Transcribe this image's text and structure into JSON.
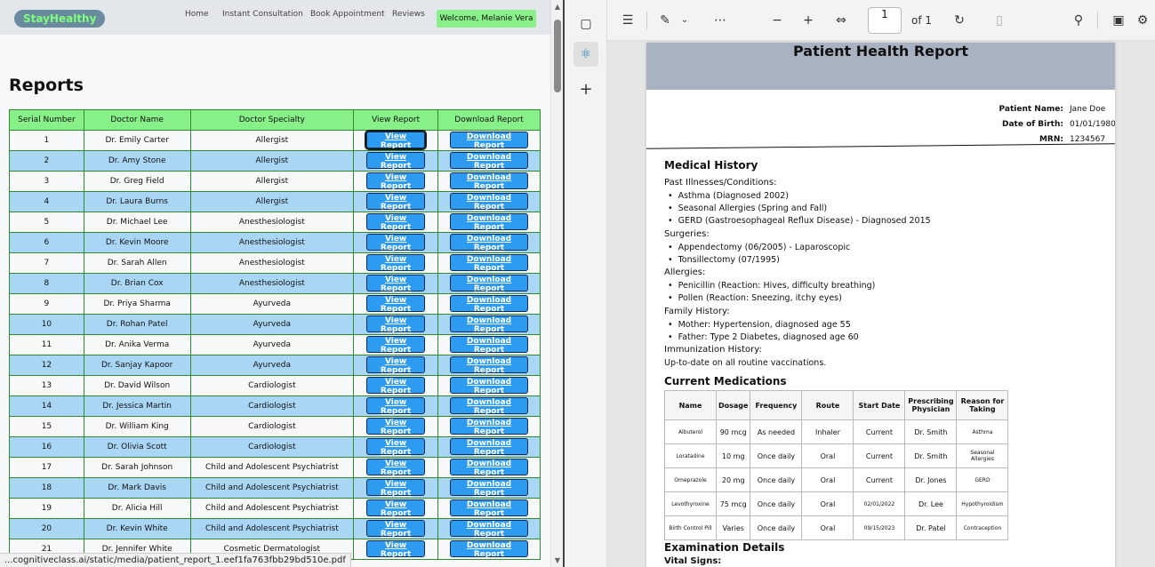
{
  "site": {
    "brand": "StayHealthy",
    "nav": [
      "Home",
      "Instant Consultation",
      "Book Appointment",
      "Reviews"
    ],
    "welcome": "Welcome, Melanie Vera",
    "page_title": "Reports",
    "table_headers": [
      "Serial Number",
      "Doctor Name",
      "Doctor Specialty",
      "View Report",
      "Download Report"
    ],
    "view_label": "View Report",
    "download_label": "Download Report",
    "rows": [
      {
        "n": "1",
        "doctor": "Dr. Emily Carter",
        "specialty": "Allergist"
      },
      {
        "n": "2",
        "doctor": "Dr. Amy Stone",
        "specialty": "Allergist"
      },
      {
        "n": "3",
        "doctor": "Dr. Greg Field",
        "specialty": "Allergist"
      },
      {
        "n": "4",
        "doctor": "Dr. Laura Burns",
        "specialty": "Allergist"
      },
      {
        "n": "5",
        "doctor": "Dr. Michael Lee",
        "specialty": "Anesthesiologist"
      },
      {
        "n": "6",
        "doctor": "Dr. Kevin Moore",
        "specialty": "Anesthesiologist"
      },
      {
        "n": "7",
        "doctor": "Dr. Sarah Allen",
        "specialty": "Anesthesiologist"
      },
      {
        "n": "8",
        "doctor": "Dr. Brian Cox",
        "specialty": "Anesthesiologist"
      },
      {
        "n": "9",
        "doctor": "Dr. Priya Sharma",
        "specialty": "Ayurveda"
      },
      {
        "n": "10",
        "doctor": "Dr. Rohan Patel",
        "specialty": "Ayurveda"
      },
      {
        "n": "11",
        "doctor": "Dr. Anika Verma",
        "specialty": "Ayurveda"
      },
      {
        "n": "12",
        "doctor": "Dr. Sanjay Kapoor",
        "specialty": "Ayurveda"
      },
      {
        "n": "13",
        "doctor": "Dr. David Wilson",
        "specialty": "Cardiologist"
      },
      {
        "n": "14",
        "doctor": "Dr. Jessica Martin",
        "specialty": "Cardiologist"
      },
      {
        "n": "15",
        "doctor": "Dr. William King",
        "specialty": "Cardiologist"
      },
      {
        "n": "16",
        "doctor": "Dr. Olivia Scott",
        "specialty": "Cardiologist"
      },
      {
        "n": "17",
        "doctor": "Dr. Sarah Johnson",
        "specialty": "Child and Adolescent Psychiatrist"
      },
      {
        "n": "18",
        "doctor": "Dr. Mark Davis",
        "specialty": "Child and Adolescent Psychiatrist"
      },
      {
        "n": "19",
        "doctor": "Dr. Alicia Hill",
        "specialty": "Child and Adolescent Psychiatrist"
      },
      {
        "n": "20",
        "doctor": "Dr. Kevin White",
        "specialty": "Child and Adolescent Psychiatrist"
      },
      {
        "n": "21",
        "doctor": "Dr. Jennifer White",
        "specialty": "Cosmetic Dermatologist"
      }
    ],
    "status_url": "...cognitiveclass.ai/static/media/patient_report_1.eef1fa763fbb29bd510e.pdf"
  },
  "viewer": {
    "page_current": "1",
    "page_of": "of 1",
    "toolbar_icons": [
      "contents-icon",
      "draw-icon",
      "chevron-down-icon",
      "more-icon",
      "zoom-out-icon",
      "zoom-in-icon",
      "fit-width-icon",
      "rotate-icon",
      "two-page-icon",
      "search-icon",
      "save-icon",
      "settings-icon"
    ]
  },
  "pdf": {
    "title": "Patient Health Report",
    "patient": [
      {
        "label": "Patient Name:",
        "value": "Jane Doe"
      },
      {
        "label": "Date of Birth:",
        "value": "01/01/1980"
      },
      {
        "label": "MRN:",
        "value": "1234567"
      }
    ],
    "medical_history_title": "Medical History",
    "past_title": "Past Illnesses/Conditions:",
    "past": [
      "Asthma (Diagnosed 2002)",
      "Seasonal Allergies (Spring and Fall)",
      "GERD (Gastroesophageal Reflux Disease) - Diagnosed 2015"
    ],
    "surgeries_title": "Surgeries:",
    "surgeries": [
      "Appendectomy (06/2005) - Laparoscopic",
      "Tonsillectomy (07/1995)"
    ],
    "allergies_title": "Allergies:",
    "allergies": [
      "Penicillin (Reaction: Hives, difficulty breathing)",
      "Pollen (Reaction: Sneezing, itchy eyes)"
    ],
    "family_title": "Family History:",
    "family": [
      "Mother: Hypertension, diagnosed age 55",
      "Father: Type 2 Diabetes, diagnosed age 60"
    ],
    "immunization_title": "Immunization History:",
    "immunization": "Up-to-date on all routine vaccinations.",
    "meds_title": "Current Medications",
    "meds_headers": [
      "Name",
      "Dosage",
      "Frequency",
      "Route",
      "Start Date",
      "Prescribing Physician",
      "Reason for Taking"
    ],
    "meds": [
      [
        "Albuterol",
        "90 mcg",
        "As needed",
        "Inhaler",
        "Current",
        "Dr. Smith",
        "Asthma"
      ],
      [
        "Loratadine",
        "10 mg",
        "Once daily",
        "Oral",
        "Current",
        "Dr. Smith",
        "Seasonal Allergies"
      ],
      [
        "Omeprazole",
        "20 mg",
        "Once daily",
        "Oral",
        "Current",
        "Dr. Jones",
        "GERD"
      ],
      [
        "Levothyroxine",
        "75 mcg",
        "Once daily",
        "Oral",
        "02/01/2022",
        "Dr. Lee",
        "Hypothyroidism"
      ],
      [
        "Birth Control Pill",
        "Varies",
        "Once daily",
        "Oral",
        "09/15/2023",
        "Dr. Patel",
        "Contraception"
      ]
    ],
    "exam_title": "Examination Details",
    "vitals_title": "Vital Signs:"
  }
}
